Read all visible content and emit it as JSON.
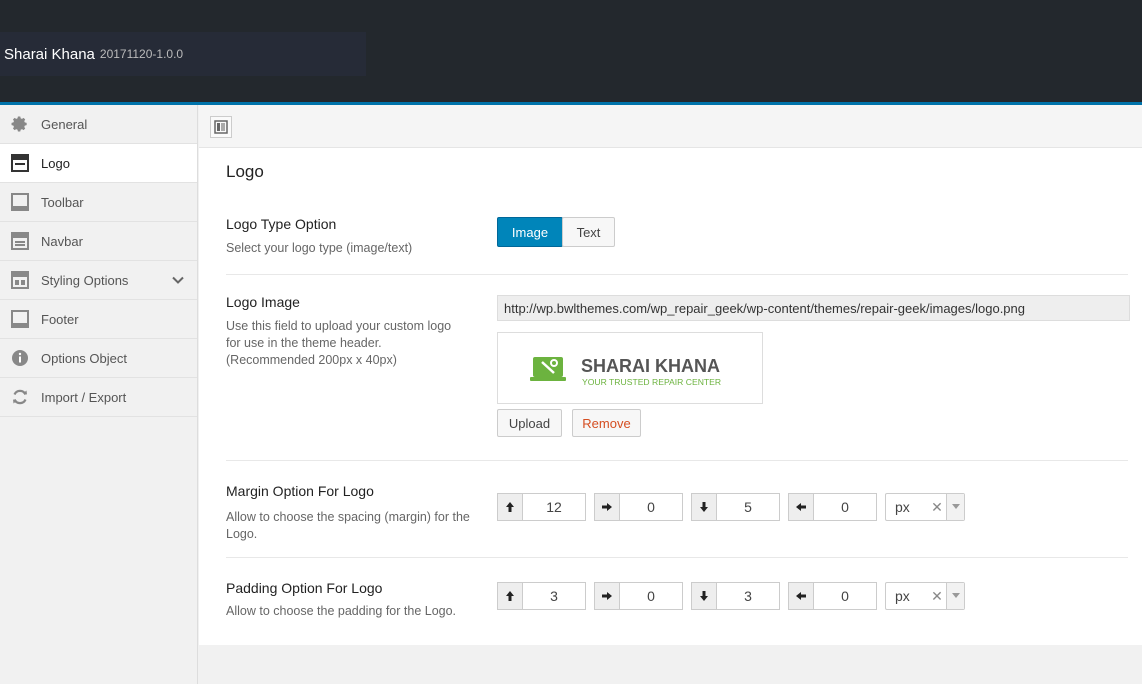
{
  "header": {
    "title": "Sharai Khana",
    "version": "20171120-1.0.0"
  },
  "sidebar": {
    "items": [
      {
        "label": "General",
        "icon": "gear-icon"
      },
      {
        "label": "Logo",
        "icon": "window-icon"
      },
      {
        "label": "Toolbar",
        "icon": "toolbar-icon"
      },
      {
        "label": "Navbar",
        "icon": "navbar-icon"
      },
      {
        "label": "Styling Options",
        "icon": "styling-icon"
      },
      {
        "label": "Footer",
        "icon": "footer-icon"
      },
      {
        "label": "Options Object",
        "icon": "info-icon"
      },
      {
        "label": "Import / Export",
        "icon": "refresh-icon"
      }
    ]
  },
  "section": {
    "title": "Logo"
  },
  "logo_type": {
    "label": "Logo Type Option",
    "desc": "Select your logo type (image/text)",
    "options": [
      "Image",
      "Text"
    ],
    "selected": "Image"
  },
  "logo_image": {
    "label": "Logo Image",
    "desc_line1": "Use this field to upload your custom logo",
    "desc_line2": "for use in the theme header.",
    "desc_line3": "(Recommended 200px x 40px)",
    "url": "http://wp.bwlthemes.com/wp_repair_geek/wp-content/themes/repair-geek/images/logo.png",
    "preview_title": "SHARAI KHANA",
    "preview_tagline": "YOUR TRUSTED REPAIR CENTER",
    "upload_label": "Upload",
    "remove_label": "Remove"
  },
  "margin": {
    "label": "Margin Option For Logo",
    "desc_line1": "Allow to choose the spacing (margin) for the",
    "desc_line2": "Logo.",
    "top": "12",
    "right": "0",
    "bottom": "5",
    "left": "0",
    "unit": "px"
  },
  "padding": {
    "label": "Padding Option For Logo",
    "desc": "Allow to choose the padding for the Logo.",
    "top": "3",
    "right": "0",
    "bottom": "3",
    "left": "0",
    "unit": "px"
  },
  "colors": {
    "header_bg": "#23282d",
    "accent": "#0073aa",
    "primary_btn": "#0085ba",
    "remove": "#d54e21",
    "logo_green": "#6cb33f"
  }
}
